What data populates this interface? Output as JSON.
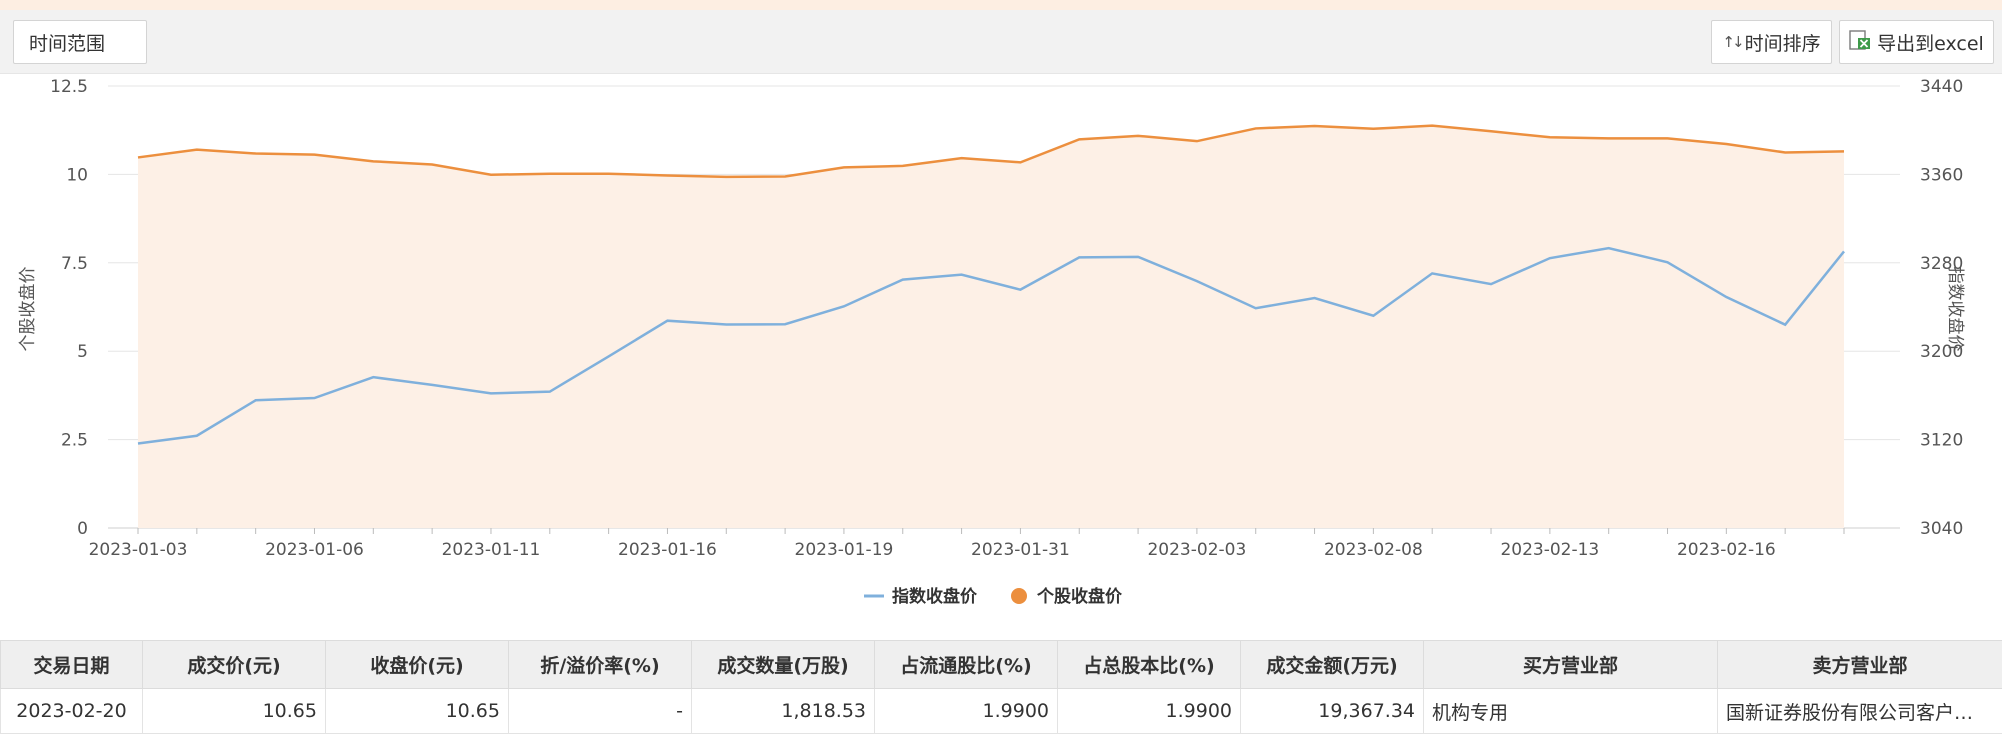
{
  "toolbar": {
    "range_label": "时间范围",
    "sort_label": "时间排序",
    "export_label": "导出到excel"
  },
  "colors": {
    "index_line": "#7fb0dc",
    "stock_line": "#ec8f3e",
    "stock_area": "#fdf0e6",
    "grid": "#e5e5e5",
    "axis_text": "#555555"
  },
  "chart_data": {
    "type": "line",
    "x": [
      "2023-01-03",
      "2023-01-04",
      "2023-01-05",
      "2023-01-06",
      "2023-01-09",
      "2023-01-10",
      "2023-01-11",
      "2023-01-12",
      "2023-01-13",
      "2023-01-16",
      "2023-01-17",
      "2023-01-18",
      "2023-01-19",
      "2023-01-20",
      "2023-01-30",
      "2023-01-31",
      "2023-02-01",
      "2023-02-02",
      "2023-02-03",
      "2023-02-06",
      "2023-02-07",
      "2023-02-08",
      "2023-02-09",
      "2023-02-10",
      "2023-02-13",
      "2023-02-14",
      "2023-02-15",
      "2023-02-16",
      "2023-02-17",
      "2023-02-20"
    ],
    "x_tick_labels": [
      "2023-01-03",
      "2023-01-06",
      "2023-01-11",
      "2023-01-16",
      "2023-01-19",
      "2023-01-31",
      "2023-02-03",
      "2023-02-08",
      "2023-02-13",
      "2023-02-16"
    ],
    "series": [
      {
        "name": "指数收盘价",
        "axis": "right",
        "style": "line",
        "values": [
          3116.5,
          3123.5,
          3155.6,
          3157.6,
          3176.5,
          3169.5,
          3161.8,
          3163.4,
          3195.3,
          3227.6,
          3224.2,
          3224.4,
          3240.6,
          3264.8,
          3269.3,
          3255.7,
          3284.9,
          3285.4,
          3263.4,
          3238.9,
          3248.1,
          3232.1,
          3270.4,
          3260.7,
          3284.2,
          3293.3,
          3280.5,
          3249.0,
          3224.0,
          3290.3
        ]
      },
      {
        "name": "个股收盘价",
        "axis": "left",
        "style": "area",
        "values": [
          10.48,
          10.7,
          10.59,
          10.56,
          10.37,
          10.28,
          9.99,
          10.02,
          10.02,
          9.97,
          9.93,
          9.94,
          10.2,
          10.24,
          10.46,
          10.34,
          10.99,
          11.09,
          10.94,
          11.3,
          11.37,
          11.29,
          11.38,
          11.22,
          11.05,
          11.02,
          11.02,
          10.86,
          10.62,
          10.65
        ]
      }
    ],
    "y_left": {
      "label": "个股收盘价",
      "min": 0,
      "max": 12.5,
      "ticks": [
        "0",
        "2.5",
        "5",
        "7.5",
        "10",
        "12.5"
      ]
    },
    "y_right": {
      "label": "指数收盘价",
      "min": 3040,
      "max": 3440,
      "ticks": [
        "3040",
        "3120",
        "3200",
        "3280",
        "3360",
        "3440"
      ]
    },
    "grid": true,
    "legend_position": "bottom"
  },
  "table": {
    "headers": [
      "交易日期",
      "成交价(元)",
      "收盘价(元)",
      "折/溢价率(%)",
      "成交数量(万股)",
      "占流通股比(%)",
      "占总股本比(%)",
      "成交金额(万元)",
      "买方营业部",
      "卖方营业部"
    ],
    "rows": [
      [
        "2023-02-20",
        "10.65",
        "10.65",
        "-",
        "1,818.53",
        "1.9900",
        "1.9900",
        "19,367.34",
        "机构专用",
        "国新证券股份有限公司客户…"
      ]
    ]
  }
}
